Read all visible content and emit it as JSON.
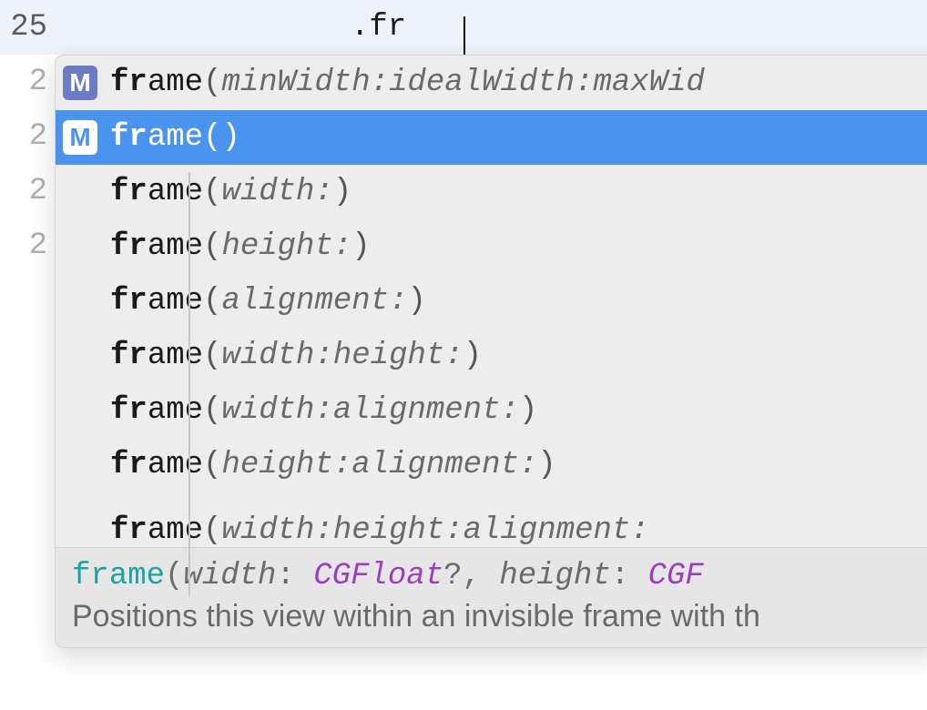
{
  "editor": {
    "current_line_number": "25",
    "partial_numbers": [
      "2",
      "2",
      "2",
      "2"
    ],
    "typed_text": ".fr"
  },
  "suggestions": [
    {
      "icon": "M",
      "match": "fr",
      "rest": "ame",
      "params": "minWidth:idealWidth:maxWid",
      "selected": false
    },
    {
      "icon": "M",
      "match": "fr",
      "rest": "ame",
      "params": "",
      "selected": true
    },
    {
      "icon": "",
      "match": "fr",
      "rest": "ame",
      "params": "width:",
      "selected": false
    },
    {
      "icon": "",
      "match": "fr",
      "rest": "ame",
      "params": "height:",
      "selected": false
    },
    {
      "icon": "",
      "match": "fr",
      "rest": "ame",
      "params": "alignment:",
      "selected": false
    },
    {
      "icon": "",
      "match": "fr",
      "rest": "ame",
      "params": "width:height:",
      "selected": false
    },
    {
      "icon": "",
      "match": "fr",
      "rest": "ame",
      "params": "width:alignment:",
      "selected": false
    },
    {
      "icon": "",
      "match": "fr",
      "rest": "ame",
      "params": "height:alignment:",
      "selected": false
    },
    {
      "icon": "",
      "match": "fr",
      "rest": "ame",
      "params": "width:height:alignment:",
      "selected": false,
      "partial": true
    }
  ],
  "doc": {
    "fn": "frame",
    "sig_prefix": "(",
    "label1": "width",
    "colon1": ": ",
    "type1": "CGFloat",
    "opt1": "?",
    "comma": ",  ",
    "label2": "height",
    "colon2": ": ",
    "type2": "CGF",
    "description": "Positions this view within an invisible frame with th"
  },
  "icon_letter": "M"
}
